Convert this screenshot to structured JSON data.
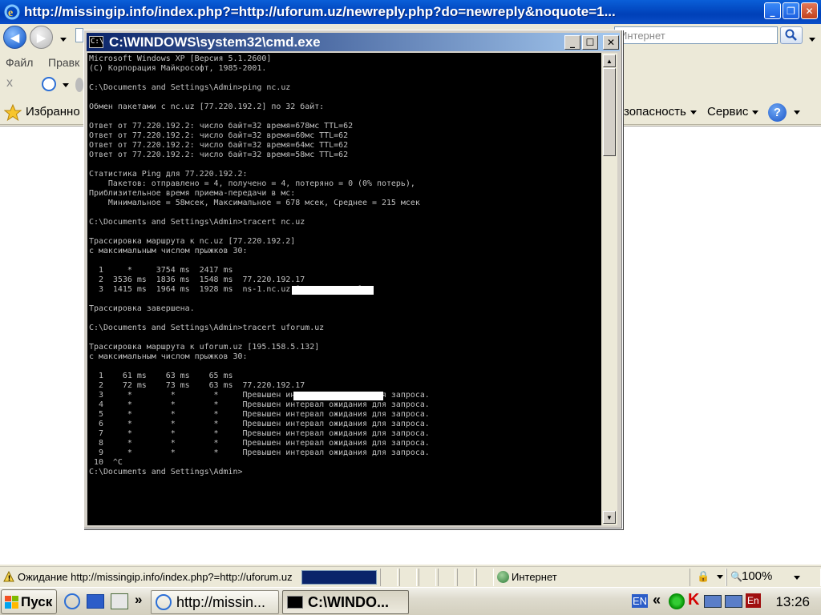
{
  "ie": {
    "title": "http://missingip.info/index.php?=http://uforum.uz/newreply.php?do=newreply&noquote=1...",
    "search_placeholder": "Интернет",
    "menu": [
      "Файл",
      "Правк"
    ],
    "menu_partial": "x",
    "favorites_label": "Избранно",
    "safety_label": "зопасность",
    "service_label": "Сервис"
  },
  "status": {
    "text": "Ожидание http://missingip.info/index.php?=http://uforum.uz",
    "progress_percent": 100,
    "zone": "Интернет",
    "zoom": "100%"
  },
  "taskbar": {
    "start_label": "Пуск",
    "tasks": [
      {
        "label": "http://missin..."
      },
      {
        "label": "C:\\WINDO..."
      }
    ],
    "lang_indicator": "EN",
    "lang_indicator2": "En",
    "clock": "13:26"
  },
  "cmd": {
    "title": "C:\\WINDOWS\\system32\\cmd.exe",
    "icon_text": "C:\\",
    "lines": [
      "Microsoft Windows XP [Версия 5.1.2600]",
      "(С) Корпорация Майкрософт, 1985-2001.",
      "",
      "C:\\Documents and Settings\\Admin>ping nc.uz",
      "",
      "Обмен пакетами с nc.uz [77.220.192.2] по 32 байт:",
      "",
      "Ответ от 77.220.192.2: число байт=32 время=678мс TTL=62",
      "Ответ от 77.220.192.2: число байт=32 время=60мс TTL=62",
      "Ответ от 77.220.192.2: число байт=32 время=64мс TTL=62",
      "Ответ от 77.220.192.2: число байт=32 время=58мс TTL=62",
      "",
      "Статистика Ping для 77.220.192.2:",
      "    Пакетов: отправлено = 4, получено = 4, потеряно = 0 (0% потерь),",
      "Приблизительное время приема-передачи в мс:",
      "    Минимальное = 58мсек, Максимальное = 678 мсек, Среднее = 215 мсек",
      "",
      "C:\\Documents and Settings\\Admin>tracert nc.uz",
      "",
      "Трассировка маршрута к nc.uz [77.220.192.2]",
      "с максимальным числом прыжков 30:",
      "",
      "  1     *     3754 ms  2417 ms  ",
      "  2  3536 ms  1836 ms  1548 ms  77.220.192.17",
      "  3  1415 ms  1964 ms  1928 ms  ns-1.nc.uz [77.220.192.2]",
      "",
      "Трассировка завершена.",
      "",
      "C:\\Documents and Settings\\Admin>tracert uforum.uz",
      "",
      "Трассировка маршрута к uforum.uz [195.158.5.132]",
      "с максимальным числом прыжков 30:",
      "",
      "  1    61 ms    63 ms    65 ms  ",
      "  2    72 ms    73 ms    63 ms  77.220.192.17",
      "  3     *        *        *     Превышен интервал ожидания для запроса.",
      "  4     *        *        *     Превышен интервал ожидания для запроса.",
      "  5     *        *        *     Превышен интервал ожидания для запроса.",
      "  6     *        *        *     Превышен интервал ожидания для запроса.",
      "  7     *        *        *     Превышен интервал ожидания для запроса.",
      "  8     *        *        *     Превышен интервал ожидания для запроса.",
      "  9     *        *        *     Превышен интервал ожидания для запроса.",
      " 10  ^C",
      "C:\\Documents and Settings\\Admin>"
    ]
  }
}
